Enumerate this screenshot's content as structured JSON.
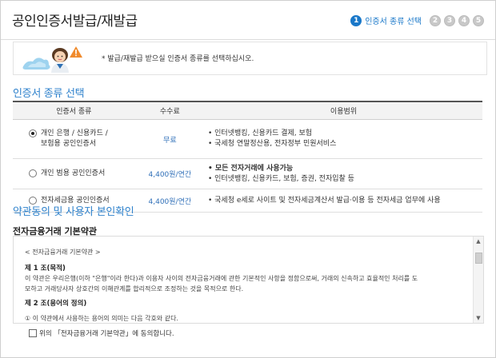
{
  "header": {
    "title": "공인인증서발급/재발급",
    "active_step": "1",
    "active_step_label": "인증서 종류 선택",
    "other_steps": [
      "2",
      "3",
      "4",
      "5"
    ]
  },
  "notice": {
    "text": "* 발급/재발급 받으실 인증서 종류를 선택하십시오."
  },
  "section1": {
    "title": "인증서 종류 선택",
    "columns": [
      "인증서 종류",
      "수수료",
      "이용범위"
    ],
    "rows": [
      {
        "type_lines": [
          "개인 은행 / 신용카드 /",
          "보험용 공인인증서"
        ],
        "fee": "무료",
        "usage": [
          "• 인터넷뱅킹, 신용카드 결제, 보험",
          "• 국세청 연말정산용, 전자정부 민원서비스"
        ],
        "selected": true
      },
      {
        "type_lines": [
          "개인 범용 공인인증서"
        ],
        "fee": "4,400원/연간",
        "usage": [
          "• 모든 전자거래에 사용가능",
          "• 인터넷뱅킹, 신용카드, 보험, 증권, 전자입찰 등"
        ],
        "selected": false
      },
      {
        "type_lines": [
          "전자세금용 공인인증서"
        ],
        "fee": "4,400원/연간",
        "usage": [
          "• 국세청 e세로 사이트 및 전자세금계산서 발급·이용 등 전자세금 업무에 사용"
        ],
        "selected": false
      }
    ]
  },
  "section2": {
    "title": "약관동의 및 사용자 본인확인",
    "terms_title": "전자금융거래 기본약관",
    "terms_box": {
      "heading": "< 전자금융거래 기본약관 >",
      "article1_title": "제 1 조(목적)",
      "article1_line1": "이 약관은 우리은행(이하 \"은행\"이라 한다)과 이용자 사이의 전자금융거래에 관한 기본적인 사항을 정함으로써, 거래의 신속하고 효율적인 처리를 도",
      "article1_line2": "모하고 거래당사자 상호간의 이해관계를 합리적으로 조정하는 것을 목적으로 한다.",
      "article2_title": "제 2 조(용어의 정의)",
      "article2_line1": "① 이 약관에서 사용하는 용어의 의미는 다음 각호와 같다."
    },
    "agree_label": "위의 「전자금융거래 기본약관」에 동의합니다."
  }
}
